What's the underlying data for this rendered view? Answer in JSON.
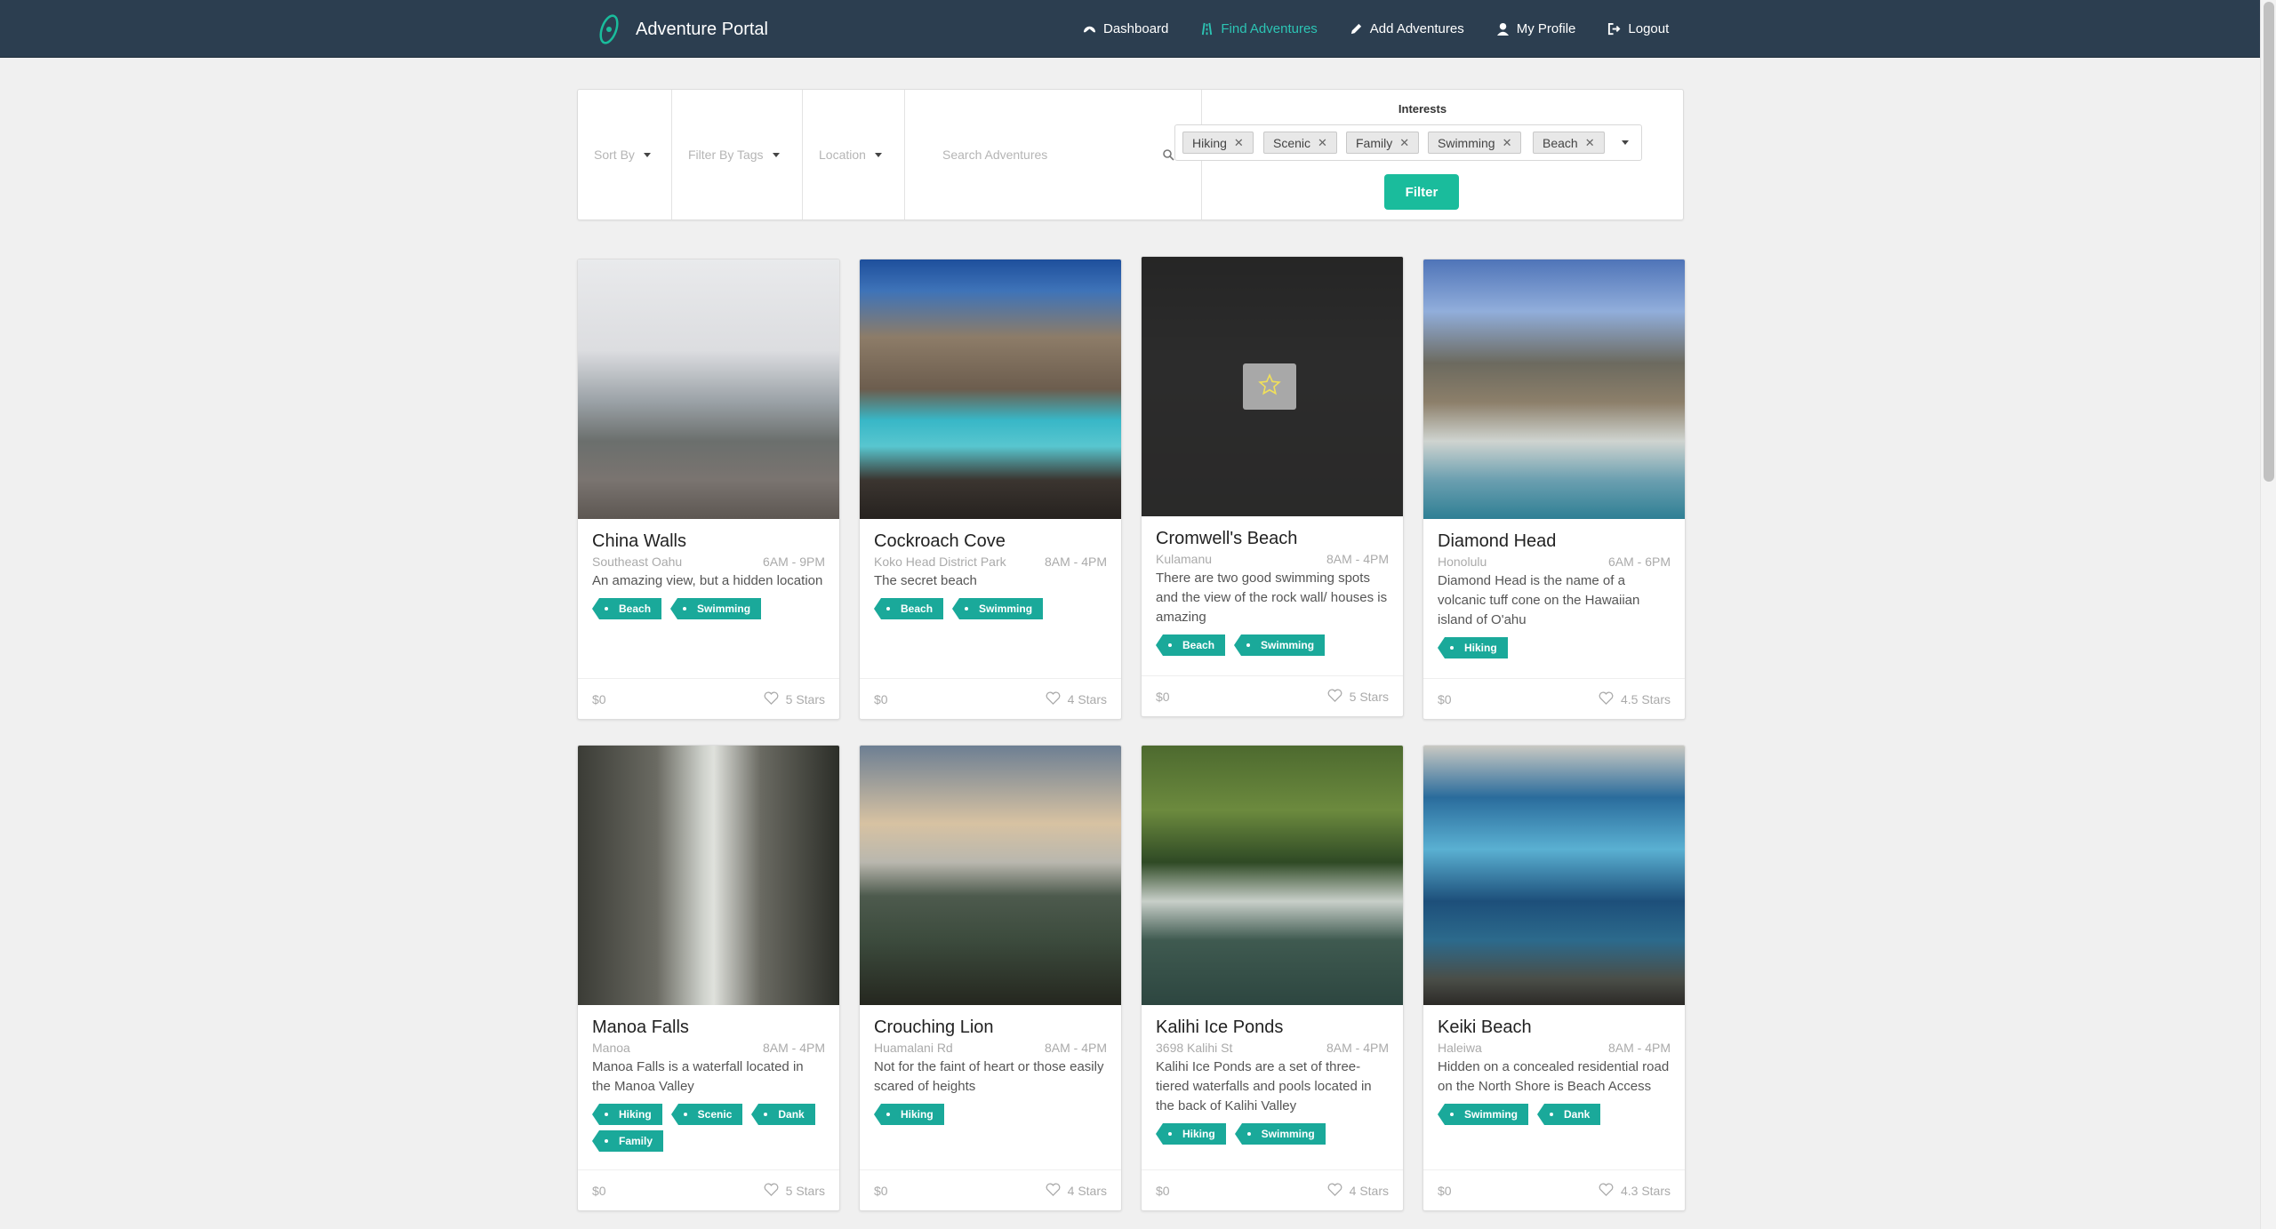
{
  "app": {
    "brand": "Adventure Portal",
    "nav": [
      {
        "label": "Dashboard",
        "icon": "dashboard-icon"
      },
      {
        "label": "Find Adventures",
        "icon": "road-icon",
        "active": true
      },
      {
        "label": "Add Adventures",
        "icon": "pencil-icon"
      },
      {
        "label": "My Profile",
        "icon": "user-icon"
      },
      {
        "label": "Logout",
        "icon": "logout-icon"
      }
    ]
  },
  "filters": {
    "sort_by": "Sort By",
    "filter_by_tags": "Filter By Tags",
    "location": "Location",
    "search_placeholder": "Search Adventures",
    "interests_label": "Interests",
    "interests": [
      "Hiking",
      "Scenic",
      "Family",
      "Swimming",
      "Beach"
    ],
    "filter_button": "Filter"
  },
  "colors": {
    "navbar": "#2c3e50",
    "accent": "#1abc9c",
    "tag": "#1aa99a",
    "active_nav": "#2cc4b4",
    "favorite_star": "#f1e05a"
  },
  "adventures": [
    {
      "title": "China Walls",
      "location": "Southeast Oahu",
      "hours": "6AM - 9PM",
      "description": "An amazing view, but a hidden location",
      "tags": [
        "Beach",
        "Swimming"
      ],
      "price": "$0",
      "rating": "5 Stars"
    },
    {
      "title": "Cockroach Cove",
      "location": "Koko Head District Park",
      "hours": "8AM - 4PM",
      "description": "The secret beach",
      "tags": [
        "Beach",
        "Swimming"
      ],
      "price": "$0",
      "rating": "4 Stars"
    },
    {
      "title": "Cromwell's Beach",
      "location": "Kulamanu",
      "hours": "8AM - 4PM",
      "description": "There are two good swimming spots and the view of the rock wall/ houses is amazing",
      "tags": [
        "Beach",
        "Swimming"
      ],
      "price": "$0",
      "rating": "5 Stars"
    },
    {
      "title": "Diamond Head",
      "location": "Honolulu",
      "hours": "6AM - 6PM",
      "description": "Diamond Head is the name of a volcanic tuff cone on the Hawaiian island of O'ahu",
      "tags": [
        "Hiking"
      ],
      "price": "$0",
      "rating": "4.5 Stars"
    },
    {
      "title": "Manoa Falls",
      "location": "Manoa",
      "hours": "8AM - 4PM",
      "description": "Manoa Falls is a waterfall located in the Manoa Valley",
      "tags": [
        "Hiking",
        "Scenic",
        "Dank",
        "Family"
      ],
      "price": "$0",
      "rating": "5 Stars"
    },
    {
      "title": "Crouching Lion",
      "location": "Huamalani Rd",
      "hours": "8AM - 4PM",
      "description": "Not for the faint of heart or those easily scared of heights",
      "tags": [
        "Hiking"
      ],
      "price": "$0",
      "rating": "4 Stars"
    },
    {
      "title": "Kalihi Ice Ponds",
      "location": "3698 Kalihi St",
      "hours": "8AM - 4PM",
      "description": "Kalihi Ice Ponds are a set of three-tiered waterfalls and pools located in the back of Kalihi Valley",
      "tags": [
        "Hiking",
        "Swimming"
      ],
      "price": "$0",
      "rating": "4 Stars"
    },
    {
      "title": "Keiki Beach",
      "location": "Haleiwa",
      "hours": "8AM - 4PM",
      "description": "Hidden on a concealed residential road on the North Shore is Beach Access",
      "tags": [
        "Swimming",
        "Dank"
      ],
      "price": "$0",
      "rating": "4.3 Stars"
    }
  ]
}
